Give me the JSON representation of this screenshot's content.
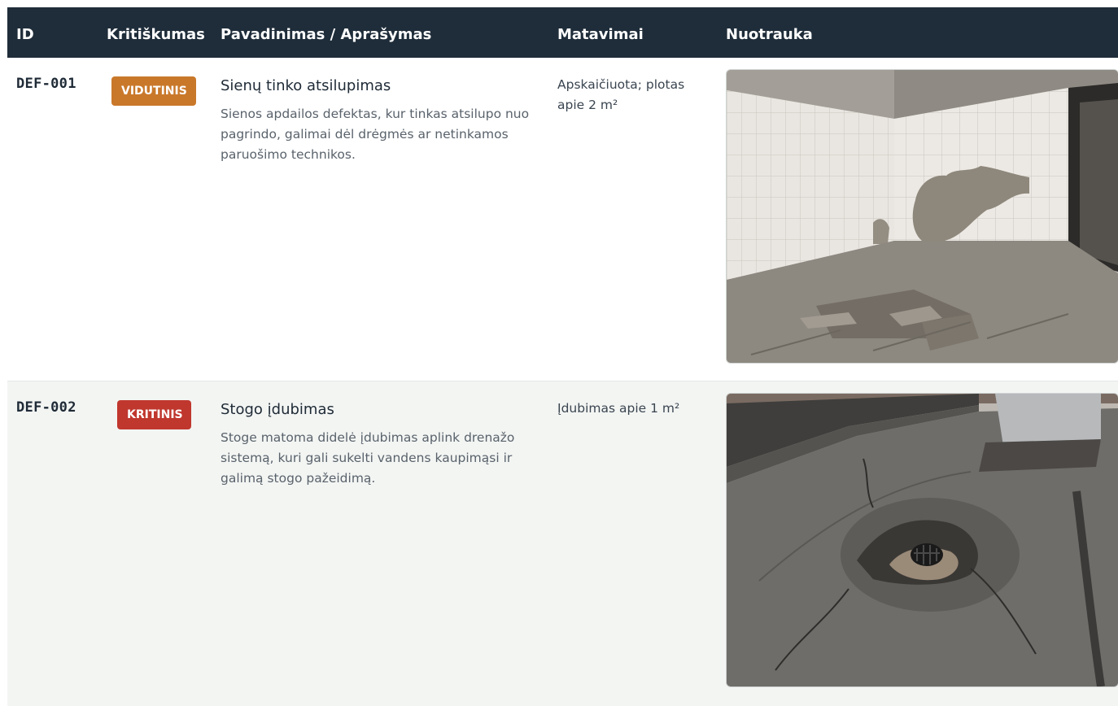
{
  "table": {
    "headers": {
      "id": "ID",
      "criticality": "Kritiškumas",
      "name": "Pavadinimas / Aprašymas",
      "measurements": "Matavimai",
      "photo": "Nuotrauka"
    },
    "rows": [
      {
        "id": "DEF-001",
        "severity": "VIDUTINIS",
        "severity_color": "#c9782a",
        "title": "Sienų tinko atsilupimas",
        "description": "Sienos apdailos defektas, kur tinkas atsilupo nuo pagrindo, galimai dėl drėgmės ar netinkamos paruošimo technikos.",
        "measurements": "Apskaičiuota; plotas apie 2 m²"
      },
      {
        "id": "DEF-002",
        "severity": "KRITINIS",
        "severity_color": "#c0372e",
        "title": "Stogo įdubimas",
        "description": "Stoge matoma didelė įdubimas aplink drenažo sistemą, kuri gali sukelti vandens kaupimąsi ir galimą stogo pažeidimą.",
        "measurements": "Įdubimas apie 1 m²"
      }
    ]
  },
  "colors": {
    "header_bg": "#1f2d3a",
    "row_alt_bg": "#f3f5f3"
  }
}
